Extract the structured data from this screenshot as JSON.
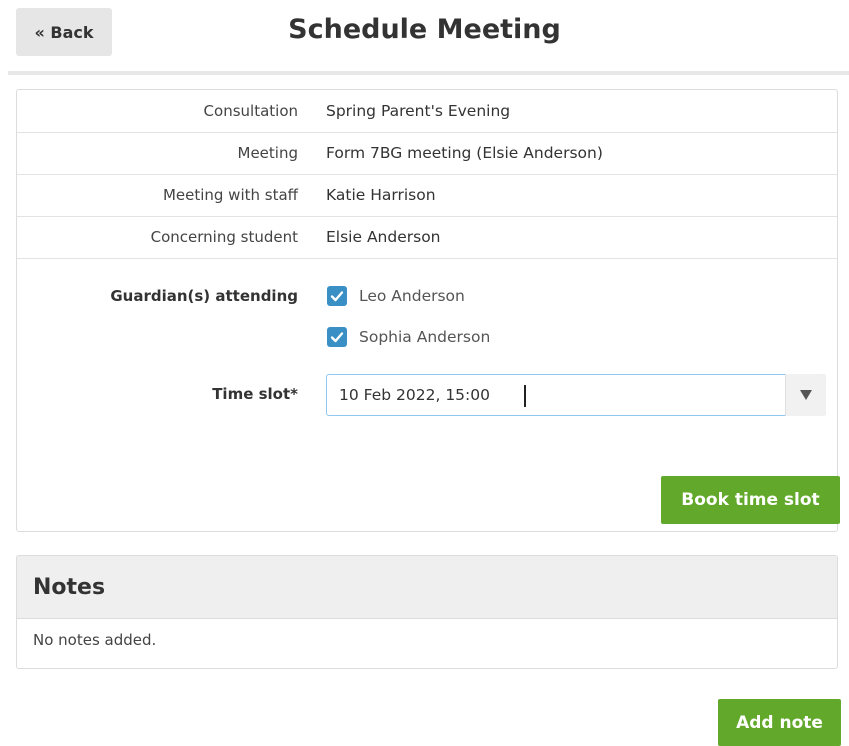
{
  "header": {
    "back_label": "« Back",
    "title": "Schedule Meeting"
  },
  "details": [
    {
      "label": "Consultation",
      "value": "Spring Parent's Evening"
    },
    {
      "label": "Meeting",
      "value": "Form 7BG meeting (Elsie Anderson)"
    },
    {
      "label": "Meeting with staff",
      "value": "Katie Harrison"
    },
    {
      "label": "Concerning student",
      "value": "Elsie Anderson"
    }
  ],
  "form": {
    "guardians_label": "Guardian(s) attending",
    "guardians": [
      {
        "name": "Leo Anderson",
        "checked": true
      },
      {
        "name": "Sophia Anderson",
        "checked": true
      }
    ],
    "timeslot_label": "Time slot*",
    "timeslot_value": "10 Feb 2022, 15:00",
    "book_label": "Book time slot"
  },
  "notes": {
    "title": "Notes",
    "empty_text": "No notes added.",
    "add_label": "Add note"
  },
  "colors": {
    "accent_green": "#62a92b",
    "checkbox_blue": "#3a8fc4",
    "focus_border": "#8fc8ee"
  }
}
